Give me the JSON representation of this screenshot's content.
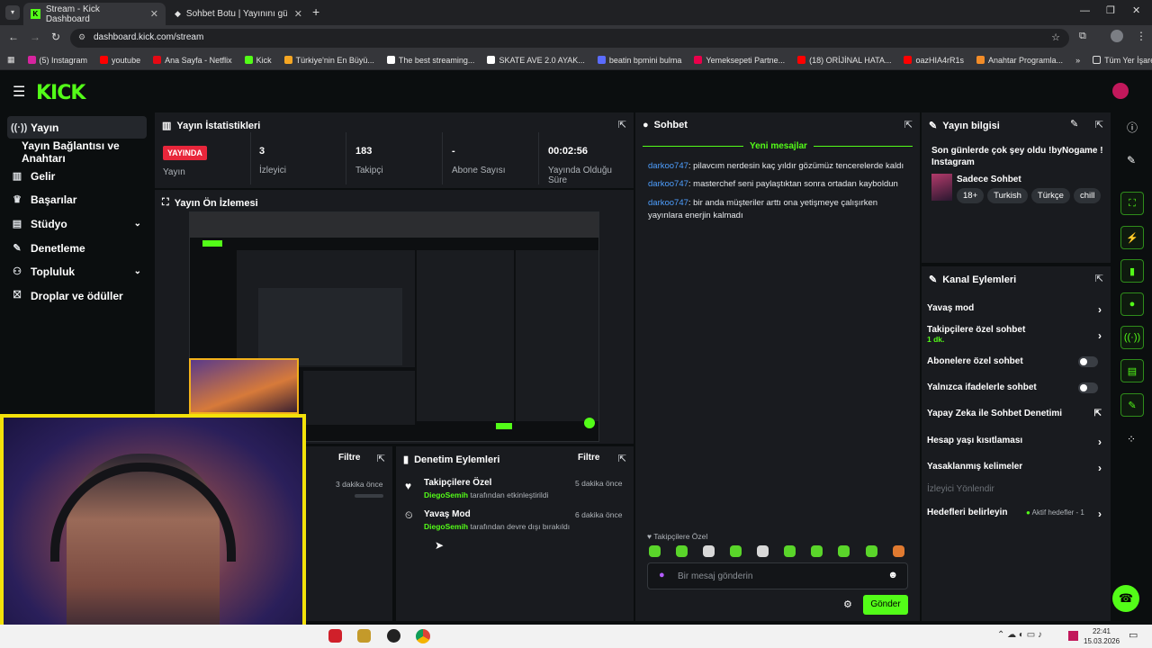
{
  "browser": {
    "tabs": [
      {
        "label": "Stream - Kick Dashboard",
        "active": true
      },
      {
        "label": "Sohbet Botu | Yayınını güçlendir",
        "active": false
      }
    ],
    "url": "dashboard.kick.com/stream",
    "bookmarks": [
      {
        "label": "(5) Instagram",
        "color": "#d6249f"
      },
      {
        "label": "youtube",
        "color": "#ff0000"
      },
      {
        "label": "Ana Sayfa - Netflix",
        "color": "#e50914"
      },
      {
        "label": "Kick",
        "color": "#53fc18"
      },
      {
        "label": "Türkiye'nin En Büyü...",
        "color": "#f5a623"
      },
      {
        "label": "The best streaming...",
        "color": "#ffffff"
      },
      {
        "label": "SKATE AVE 2.0 AYAK...",
        "color": "#ffffff"
      },
      {
        "label": "beatin bpmini bulma",
        "color": "#5b6cff"
      },
      {
        "label": "Yemeksepeti Partne...",
        "color": "#ea004b"
      },
      {
        "label": "(18) ORİJİNAL HATA...",
        "color": "#ff0000"
      },
      {
        "label": "oazHIA4rR1s",
        "color": "#ff0000"
      },
      {
        "label": "Anahtar Programla...",
        "color": "#f28c28"
      }
    ],
    "all_bookmarks": "Tüm Yer İşaretleri"
  },
  "kick": {
    "logo": "KICK",
    "accent": "#53fc18"
  },
  "sidebar": {
    "items": [
      {
        "label": "Yayın",
        "icon": "broadcast-icon"
      },
      {
        "label": "Yayın Bağlantısı ve Anahtarı",
        "icon": ""
      },
      {
        "label": "Gelir",
        "icon": "chart-icon"
      },
      {
        "label": "Başarılar",
        "icon": "trophy-icon"
      },
      {
        "label": "Stüdyo",
        "icon": "studio-icon"
      },
      {
        "label": "Denetleme",
        "icon": "wrench-icon"
      },
      {
        "label": "Topluluk",
        "icon": "community-icon"
      },
      {
        "label": "Droplar ve ödüller",
        "icon": "gift-icon"
      }
    ]
  },
  "stats": {
    "title": "Yayın İstatistikleri",
    "live_badge": "YAYINDA",
    "live_label": "Yayın",
    "viewers_value": "3",
    "viewers_label": "İzleyici",
    "followers_value": "183",
    "followers_label": "Takipçi",
    "subs_value": "-",
    "subs_label": "Abone Sayısı",
    "uptime_value": "00:02:56",
    "uptime_label": "Yayında Olduğu Süre"
  },
  "preview": {
    "title": "Yayın Ön İzlemesi"
  },
  "left_bottom": {
    "filter": "Filtre",
    "time": "3 dakika önce"
  },
  "moderation": {
    "title": "Denetim Eylemleri",
    "filter": "Filtre",
    "rows": [
      {
        "title": "Takipçilere Özel",
        "user": "DiegoSemih",
        "action": "tarafından etkinleştirildi",
        "time": "5 dakika önce"
      },
      {
        "title": "Yavaş Mod",
        "user": "DiegoSemih",
        "action": "tarafından devre dışı bırakıldı",
        "time": "6 dakika önce"
      }
    ]
  },
  "chat": {
    "title": "Sohbet",
    "new_messages": "Yeni mesajlar",
    "messages": [
      {
        "user": "darkoo747",
        "text": ": pilavcım nerdesin kaç yıldır gözümüz tencerelerde kaldı"
      },
      {
        "user": "darkoo747",
        "text": ": masterchef seni paylaştıktan sonra ortadan kayboldun"
      },
      {
        "user": "darkoo747",
        "text": ": bir anda müşteriler arttı ona yetişmeye çalışırken yayınlara enerjin kalmadı"
      }
    ],
    "mode_label": "Takipçilere Özel",
    "input_placeholder": "Bir mesaj gönderin",
    "send_label": "Gönder"
  },
  "stream_info": {
    "title": "Yayın bilgisi",
    "stream_title": "Son günlerde çok şey oldu !byNogame ! Instagram",
    "category": "Sadece Sohbet",
    "tags": [
      "18+",
      "Turkish",
      "Türkçe",
      "chill"
    ]
  },
  "channel_actions": {
    "title": "Kanal Eylemleri",
    "slow_mode": "Yavaş mod",
    "followers_only": "Takipçilere özel sohbet",
    "followers_only_value": "1 dk.",
    "subs_only": "Abonelere özel sohbet",
    "emotes_only": "Yalnızca ifadelerle sohbet",
    "ai_moderation": "Yapay Zeka ile Sohbet Denetimi",
    "account_age": "Hesap yaşı kısıtlaması",
    "banned_words": "Yasaklanmış kelimeler",
    "viewer_redirect": "İzleyici Yönlendir",
    "goals": "Hedefleri belirleyin",
    "goals_status": "Aktif hedefler - 1"
  },
  "taskbar": {
    "time": "22:41",
    "date": "15.03.2026"
  }
}
